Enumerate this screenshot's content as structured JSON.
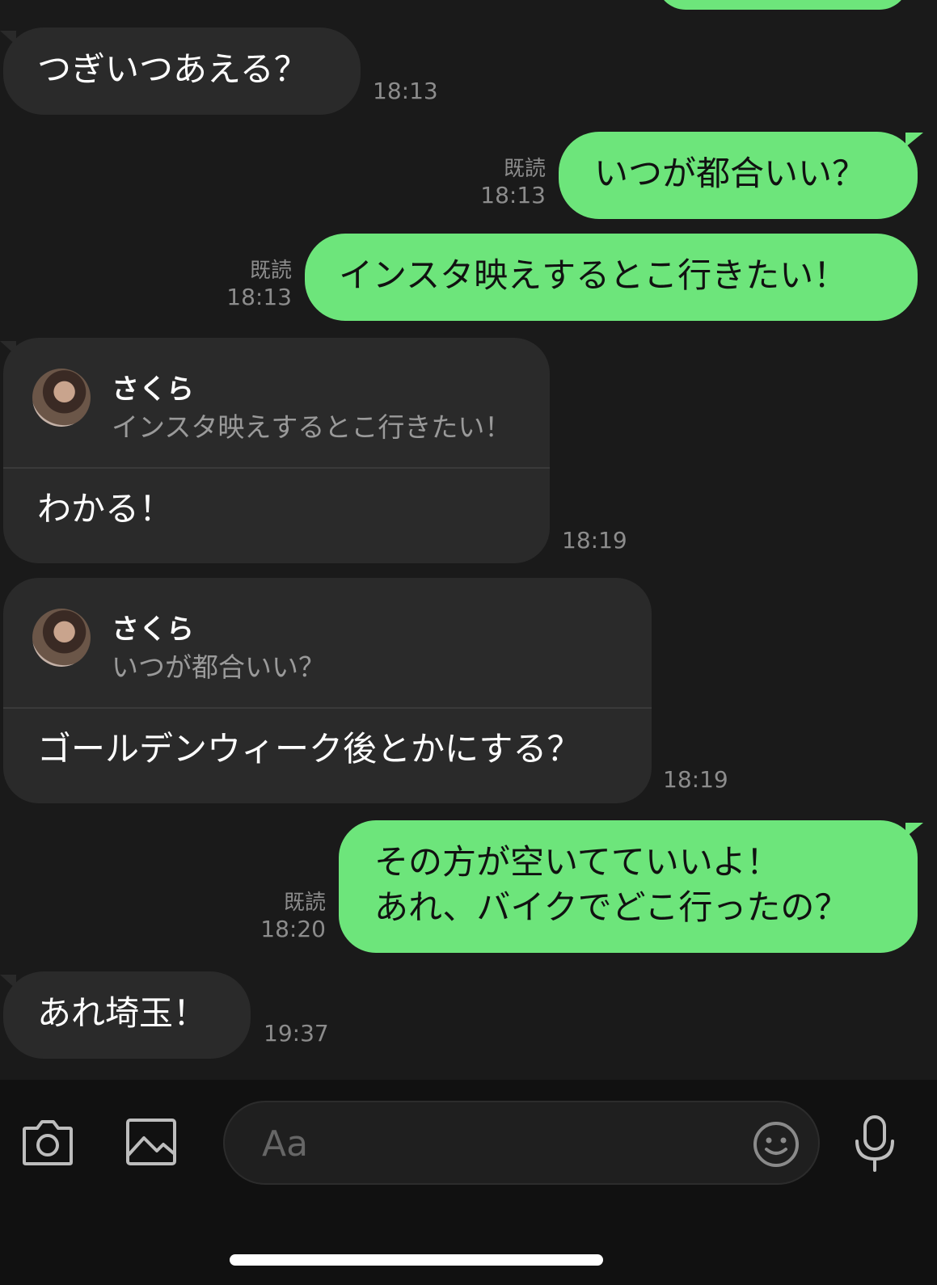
{
  "messages": [
    {
      "text": "つぎいつあえる？",
      "time": "18:13"
    },
    {
      "text": "いつが都合いい？",
      "read": "既読",
      "time": "18:13"
    },
    {
      "text": "インスタ映えするとこ行きたい！",
      "read": "既読",
      "time": "18:13"
    },
    {
      "reply_name": "さくら",
      "reply_quote": "インスタ映えするとこ行きたい！",
      "text": "わかる！",
      "time": "18:19"
    },
    {
      "reply_name": "さくら",
      "reply_quote": "いつが都合いい？",
      "text": "ゴールデンウィーク後とかにする？",
      "time": "18:19"
    },
    {
      "lines": [
        "その方が空いてていいよ！",
        "あれ、バイクでどこ行ったの？"
      ],
      "read": "既読",
      "time": "18:20"
    },
    {
      "text": "あれ埼玉！",
      "time": "19:37"
    }
  ],
  "input": {
    "placeholder": "Aa"
  },
  "icons": [
    "camera-icon",
    "image-icon",
    "emoji-icon",
    "microphone-icon"
  ],
  "colors": {
    "outgoing": "#6de57b",
    "incoming": "#2a2a2a",
    "background": "#1a1a1a"
  }
}
